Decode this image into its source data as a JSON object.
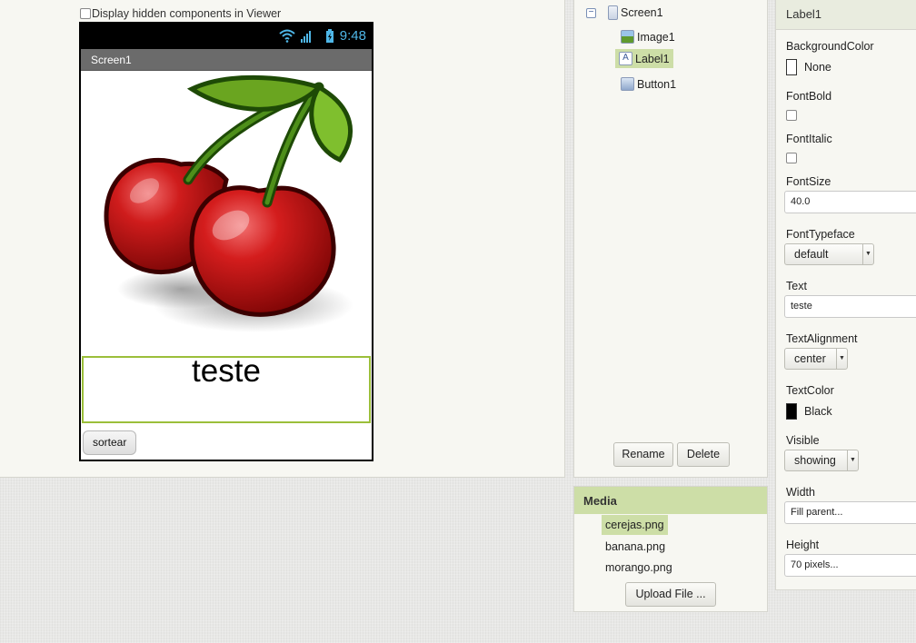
{
  "viewer": {
    "hidden_components_label": "Display hidden components in Viewer",
    "status_time": "9:48",
    "screen_title": "Screen1",
    "label_text": "teste",
    "button_text": "sortear"
  },
  "components": {
    "tree": [
      {
        "label": "Screen1"
      },
      {
        "label": "Image1"
      },
      {
        "label": "Label1"
      },
      {
        "label": "Button1"
      }
    ],
    "rename_label": "Rename",
    "delete_label": "Delete"
  },
  "media": {
    "header": "Media",
    "files": [
      "cerejas.png",
      "banana.png",
      "morango.png"
    ],
    "upload_label": "Upload File ..."
  },
  "properties": {
    "component_name": "Label1",
    "background_color": {
      "label": "BackgroundColor",
      "value": "None",
      "swatch": "#ffffff"
    },
    "font_bold": {
      "label": "FontBold"
    },
    "font_italic": {
      "label": "FontItalic"
    },
    "font_size": {
      "label": "FontSize",
      "value": "40.0"
    },
    "font_typeface": {
      "label": "FontTypeface",
      "value": "default"
    },
    "text": {
      "label": "Text",
      "value": "teste"
    },
    "text_alignment": {
      "label": "TextAlignment",
      "value": "center"
    },
    "text_color": {
      "label": "TextColor",
      "value": "Black",
      "swatch": "#000000"
    },
    "visible": {
      "label": "Visible",
      "value": "showing"
    },
    "width": {
      "label": "Width",
      "value": "Fill parent..."
    },
    "height": {
      "label": "Height",
      "value": "70 pixels..."
    }
  },
  "colors": {
    "selection": "#cddea7",
    "label_border": "#9bbf3a",
    "status_icon": "#4fb7e8"
  }
}
